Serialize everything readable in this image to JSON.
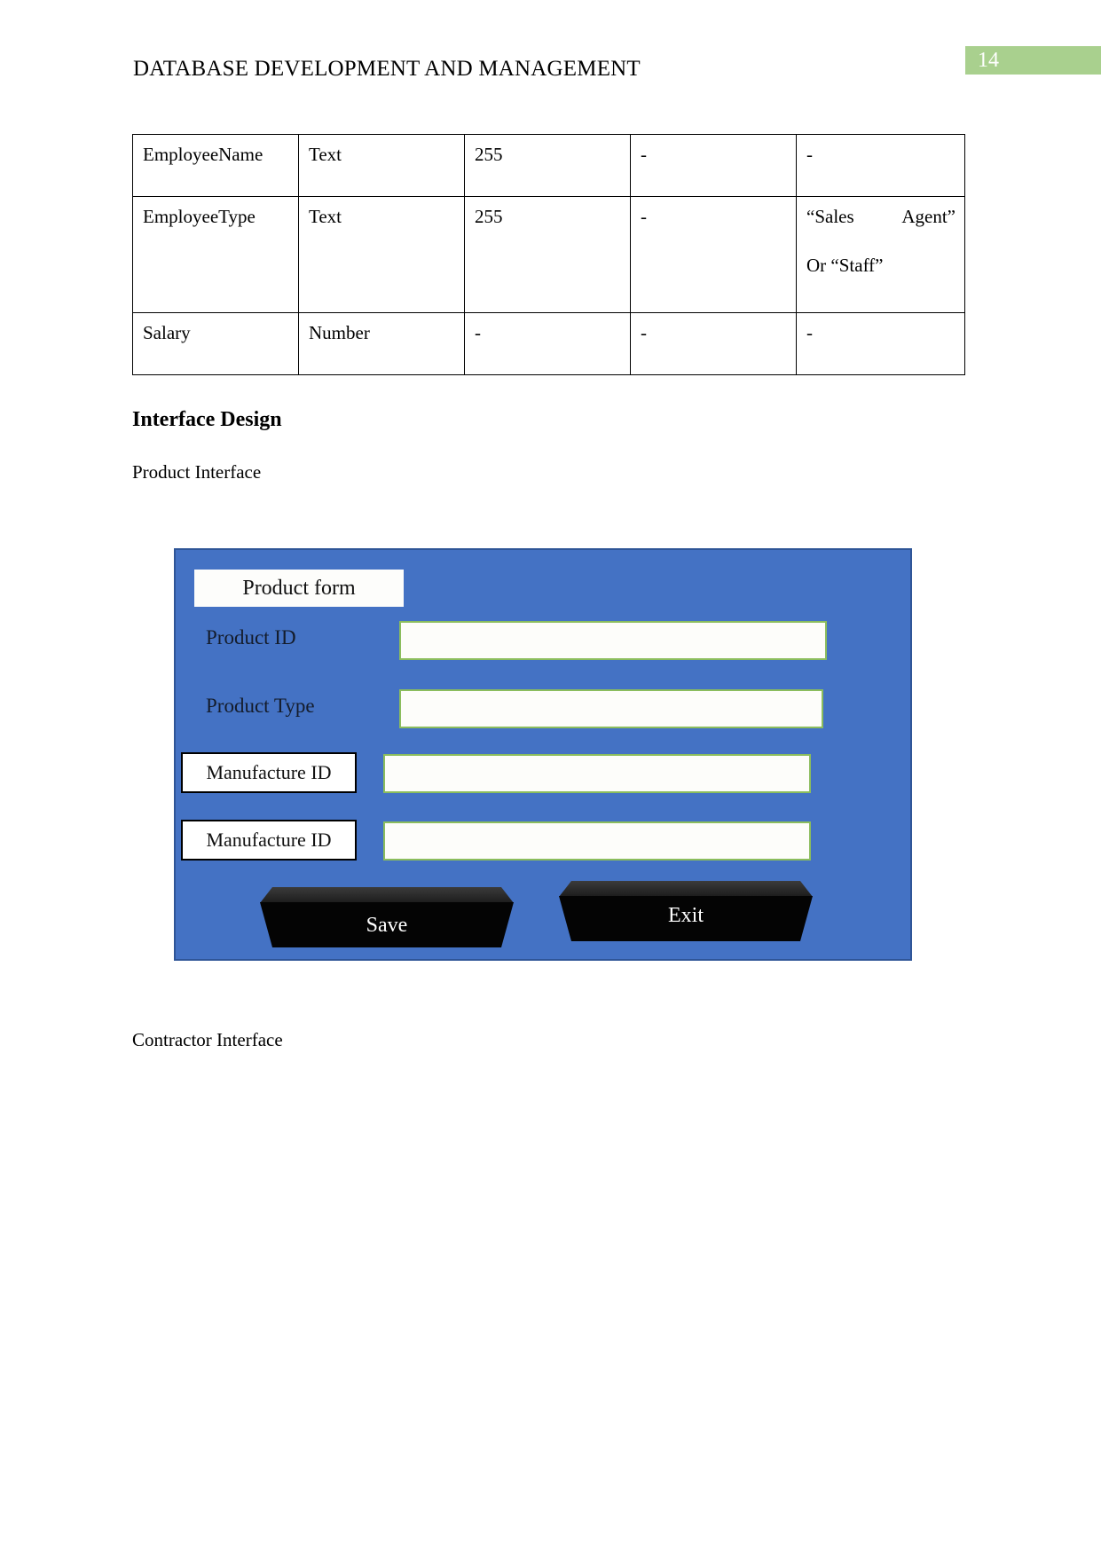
{
  "header": {
    "title": "DATABASE DEVELOPMENT AND MANAGEMENT",
    "page_number": "14",
    "badge_color": "#a9d08e"
  },
  "spec_table": {
    "rows": [
      {
        "field": "EmployeeName",
        "type": "Text",
        "size": "255",
        "key": "-",
        "remark_line1": "-",
        "remark_line2": ""
      },
      {
        "field": "EmployeeType",
        "type": "Text",
        "size": "255",
        "key": "-",
        "remark_line1": "“Sales Agent”",
        "remark_line2": "Or “Staff”"
      },
      {
        "field": "Salary",
        "type": "Number",
        "size": "-",
        "key": "-",
        "remark_line1": "-",
        "remark_line2": ""
      }
    ]
  },
  "section": {
    "heading": "Interface Design",
    "product_caption": "Product Interface",
    "contractor_caption": "Contractor Interface"
  },
  "product_form": {
    "title": "Product form",
    "background_color": "#4472c4",
    "input_border_color": "#8bbd5d",
    "fields": [
      {
        "label": "Product ID",
        "value": "",
        "style": "plain"
      },
      {
        "label": "Product Type",
        "value": "",
        "style": "plain"
      },
      {
        "label": "Manufacture ID",
        "value": "",
        "style": "boxed"
      },
      {
        "label": "Manufacture ID",
        "value": "",
        "style": "boxed"
      }
    ],
    "buttons": [
      {
        "label": "Save"
      },
      {
        "label": "Exit"
      }
    ]
  }
}
